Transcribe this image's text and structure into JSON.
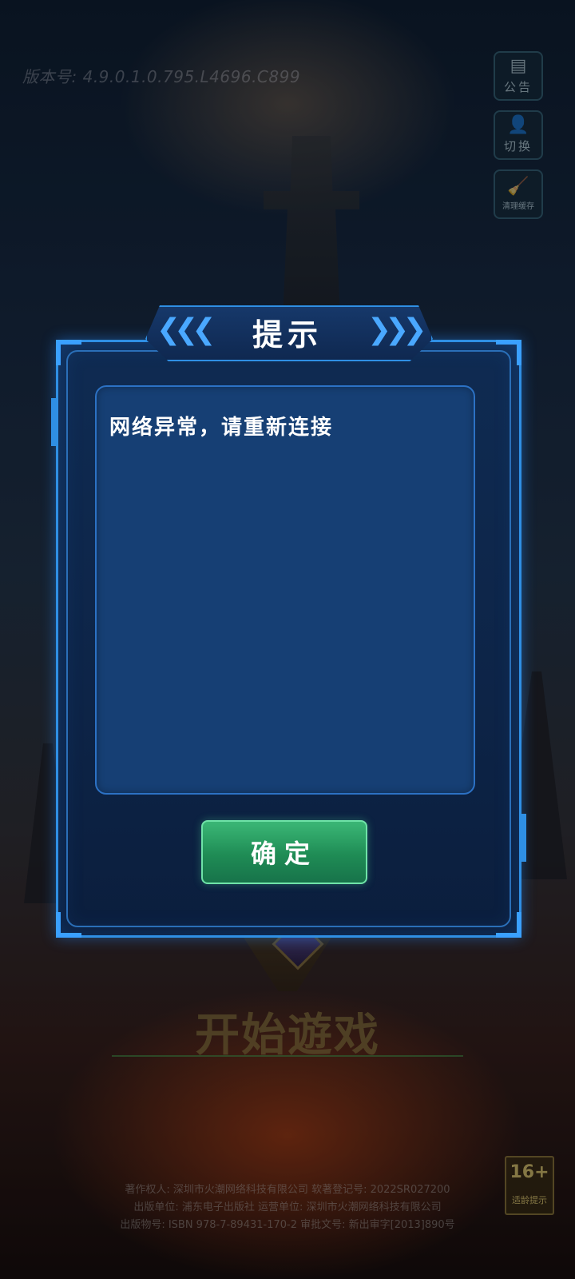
{
  "version": {
    "text": "版本号: 4.9.0.1.0.795.L4696.C899"
  },
  "side_buttons": {
    "notice": {
      "label": "公告",
      "icon": "notice-icon"
    },
    "switch": {
      "label": "切换",
      "icon": "user-switch-icon"
    },
    "clear_cache": {
      "label": "清理缓存",
      "icon": "broom-icon"
    }
  },
  "start": {
    "label": "开始遊戏"
  },
  "footer": {
    "line1": "著作权人: 深圳市火潮网络科技有限公司 软著登记号: 2022SR027200",
    "line2": "出版单位: 浦东电子出版社 运营单位: 深圳市火潮网络科技有限公司",
    "line3": "出版物号: ISBN 978-7-89431-170-2 审批文号: 新出审字[2013]890号"
  },
  "age_rating": {
    "value": "16+",
    "caption": "适龄提示"
  },
  "dialog": {
    "title": "提示",
    "message": "网络异常，请重新连接",
    "confirm_label": "确定",
    "left_chevrons": "❮❮❮",
    "right_chevrons": "❯❯❯",
    "accent_color": "#2f8fe4",
    "confirm_color": "#2a9e63"
  }
}
